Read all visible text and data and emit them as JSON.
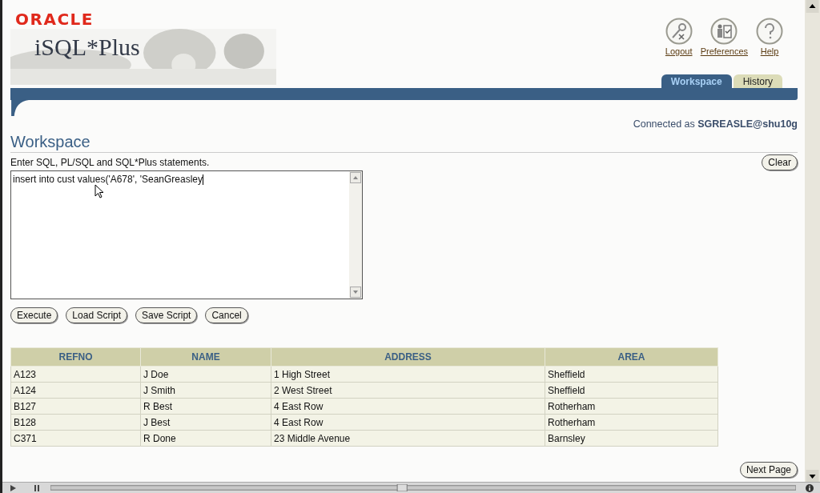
{
  "brand": {
    "company": "ORACLE",
    "product": "iSQL*Plus"
  },
  "global_links": [
    {
      "kind": "logout",
      "label": "Logout"
    },
    {
      "kind": "preferences",
      "label": "Preferences"
    },
    {
      "kind": "help",
      "label": "Help"
    }
  ],
  "tabs": [
    {
      "label": "Workspace",
      "selected": true
    },
    {
      "label": "History",
      "selected": false
    }
  ],
  "connection": {
    "prefix": "Connected as",
    "user": "SGREASLE@shu10g"
  },
  "heading": "Workspace",
  "instruction": "Enter SQL, PL/SQL and SQL*Plus statements.",
  "clear_button": "Clear",
  "editor": {
    "value": "insert into cust values('A678', 'SeanGreasley"
  },
  "buttons": [
    "Execute",
    "Load Script",
    "Save Script",
    "Cancel"
  ],
  "table": {
    "columns": [
      "REFNO",
      "NAME",
      "ADDRESS",
      "AREA"
    ],
    "rows": [
      [
        "A123",
        "J Doe",
        "1 High Street",
        "Sheffield"
      ],
      [
        "A124",
        "J Smith",
        "2 West Street",
        "Sheffield"
      ],
      [
        "B127",
        "R Best",
        "4 East Row",
        "Rotherham"
      ],
      [
        "B128",
        "J Best",
        "4 East Row",
        "Rotherham"
      ],
      [
        "C371",
        "R Done",
        "23 Middle Avenue",
        "Barnsley"
      ]
    ]
  },
  "next_button": "Next Page"
}
